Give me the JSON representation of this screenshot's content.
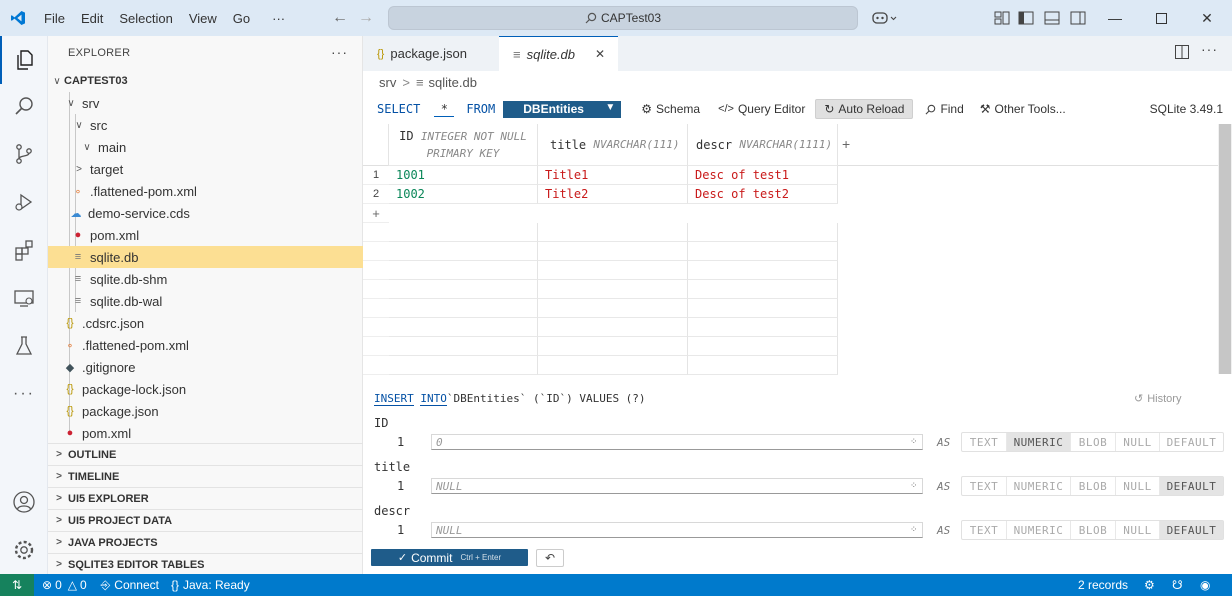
{
  "titlebar": {
    "menu": [
      "File",
      "Edit",
      "Selection",
      "View",
      "Go",
      "···"
    ],
    "search": "CAPTest03"
  },
  "explorer": {
    "title": "EXPLORER",
    "more": "···",
    "root": "CAPTEST03",
    "items": [
      {
        "label": "srv",
        "chevron": "∨"
      },
      {
        "label": "src",
        "chevron": "∨"
      },
      {
        "label": "main",
        "chevron": "∨"
      },
      {
        "label": "target",
        "chevron": ">"
      },
      {
        "label": ".flattened-pom.xml",
        "icon": "rss-icon"
      },
      {
        "label": "demo-service.cds",
        "icon": "cds-icon"
      },
      {
        "label": "pom.xml",
        "icon": "maven-icon"
      },
      {
        "label": "sqlite.db",
        "icon": "db-file-icon"
      },
      {
        "label": "sqlite.db-shm",
        "icon": "db-file-icon"
      },
      {
        "label": "sqlite.db-wal",
        "icon": "db-file-icon"
      },
      {
        "label": ".cdsrc.json",
        "icon": "json-icon"
      },
      {
        "label": ".flattened-pom.xml",
        "icon": "rss-icon"
      },
      {
        "label": ".gitignore",
        "icon": "git-icon"
      },
      {
        "label": "package-lock.json",
        "icon": "json-icon"
      },
      {
        "label": "package.json",
        "icon": "json-icon"
      },
      {
        "label": "pom.xml",
        "icon": "maven-icon"
      }
    ],
    "sections": [
      "OUTLINE",
      "TIMELINE",
      "UI5 EXPLORER",
      "UI5 PROJECT DATA",
      "JAVA PROJECTS",
      "SQLITE3 EDITOR TABLES"
    ]
  },
  "tabs": [
    {
      "label": "package.json",
      "icon": "json-icon"
    },
    {
      "label": "sqlite.db",
      "icon": "db-file-icon",
      "close": "✕"
    }
  ],
  "breadcrumb": {
    "folder": "srv",
    "sep": ">",
    "file": "sqlite.db"
  },
  "toolbar": {
    "select": "SELECT",
    "star": "*",
    "from": "FROM",
    "table": "DBEntities",
    "schema": "Schema",
    "query_editor": "Query Editor",
    "auto_reload": "Auto Reload",
    "find": "Find",
    "other_tools": "Other Tools...",
    "version": "SQLite 3.49.1"
  },
  "grid": {
    "columns": [
      {
        "name": "ID",
        "type": "INTEGER NOT NULL",
        "type2": "PRIMARY KEY"
      },
      {
        "name": "title",
        "type": "NVARCHAR(111)"
      },
      {
        "name": "descr",
        "type": "NVARCHAR(1111)"
      }
    ],
    "add_col": "+",
    "add_row": "+",
    "rows": [
      {
        "num": "1",
        "id": "1001",
        "title": "Title1",
        "descr": "Desc of test1"
      },
      {
        "num": "2",
        "id": "1002",
        "title": "Title2",
        "descr": "Desc of test2"
      }
    ]
  },
  "insert": {
    "kw_insert": "INSERT",
    "kw_into": "INTO",
    "statement": "`DBEntities` (`ID`) VALUES (?)",
    "history": "History",
    "as": "AS",
    "type_buttons": [
      "TEXT",
      "NUMERIC",
      "BLOB",
      "NULL",
      "DEFAULT"
    ],
    "fields": [
      {
        "name": "ID",
        "num": "1",
        "placeholder": "0",
        "selected": "NUMERIC"
      },
      {
        "name": "title",
        "num": "1",
        "placeholder": "NULL",
        "selected": "DEFAULT"
      },
      {
        "name": "descr",
        "num": "1",
        "placeholder": "NULL",
        "selected": "DEFAULT"
      }
    ],
    "commit": "Commit",
    "commit_shortcut": "Ctrl + Enter"
  },
  "status": {
    "errors": "0",
    "warnings": "0",
    "connect": "Connect",
    "java": "Java: Ready",
    "records": "2 records"
  },
  "colors": {
    "accent": "#005fb8",
    "status_bar": "#007acc",
    "remote": "#16825d",
    "selection": "#fcdf93",
    "commit": "#1f5c8a"
  }
}
